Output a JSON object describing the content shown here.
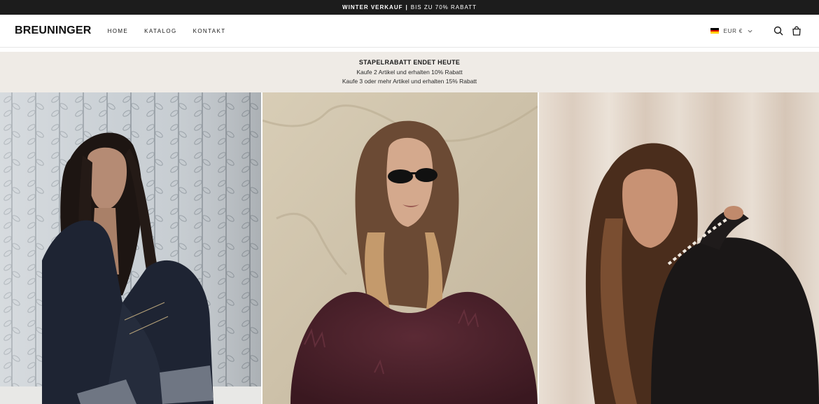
{
  "announcement": {
    "strong": "WINTER VERKAUF",
    "divider": "|",
    "sub": "BIS ZU 70% RABATT"
  },
  "header": {
    "logo": "BREUNINGER",
    "nav": [
      "HOME",
      "KATALOG",
      "KONTAKT"
    ],
    "currency": "EUR €",
    "icons": [
      "search-icon",
      "bag-icon"
    ]
  },
  "promo": {
    "title": "STAPELRABATT ENDET HEUTE",
    "line1": "Kaufe 2 Artikel und erhalten 10% Rabatt",
    "line2": "Kaufe 3 oder mehr Artikel und erhalten 15% Rabatt"
  },
  "colors": {
    "announcement_bg": "#1c1c1c",
    "promo_bg": "#efebe6",
    "text": "#1a1a1a"
  }
}
